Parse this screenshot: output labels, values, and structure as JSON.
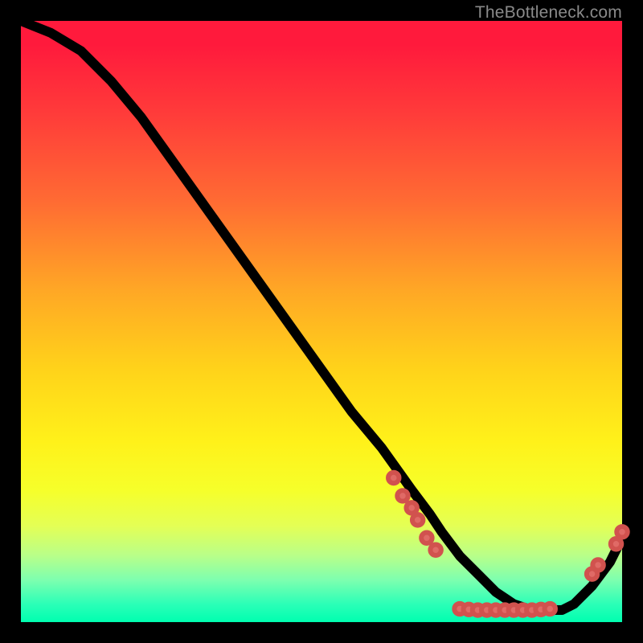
{
  "watermark": "TheBottleneck.com",
  "chart_data": {
    "type": "line",
    "title": "",
    "xlabel": "",
    "ylabel": "",
    "xlim": [
      0,
      100
    ],
    "ylim": [
      0,
      100
    ],
    "grid": false,
    "series": [
      {
        "name": "curve",
        "x": [
          0,
          5,
          10,
          15,
          20,
          25,
          30,
          35,
          40,
          45,
          50,
          55,
          60,
          65,
          68,
          70,
          73,
          76,
          79,
          82,
          85,
          88,
          90,
          92,
          95,
          98,
          100
        ],
        "y": [
          100,
          98,
          95,
          90,
          84,
          77,
          70,
          63,
          56,
          49,
          42,
          35,
          29,
          22,
          18,
          15,
          11,
          8,
          5,
          3,
          2,
          2,
          2,
          3,
          6,
          10,
          14
        ]
      }
    ],
    "markers": [
      {
        "x": 62,
        "y": 24
      },
      {
        "x": 63.5,
        "y": 21
      },
      {
        "x": 65,
        "y": 19
      },
      {
        "x": 66,
        "y": 17
      },
      {
        "x": 67.5,
        "y": 14
      },
      {
        "x": 69,
        "y": 12
      },
      {
        "x": 73,
        "y": 2.2
      },
      {
        "x": 74.5,
        "y": 2.1
      },
      {
        "x": 76,
        "y": 2.0
      },
      {
        "x": 77.5,
        "y": 2.0
      },
      {
        "x": 79,
        "y": 2.0
      },
      {
        "x": 80.5,
        "y": 2.0
      },
      {
        "x": 82,
        "y": 2.0
      },
      {
        "x": 83.5,
        "y": 2.0
      },
      {
        "x": 85,
        "y": 2.0
      },
      {
        "x": 86.5,
        "y": 2.1
      },
      {
        "x": 88,
        "y": 2.2
      },
      {
        "x": 95,
        "y": 8
      },
      {
        "x": 96,
        "y": 9.5
      },
      {
        "x": 99,
        "y": 13
      },
      {
        "x": 100,
        "y": 15
      }
    ]
  }
}
